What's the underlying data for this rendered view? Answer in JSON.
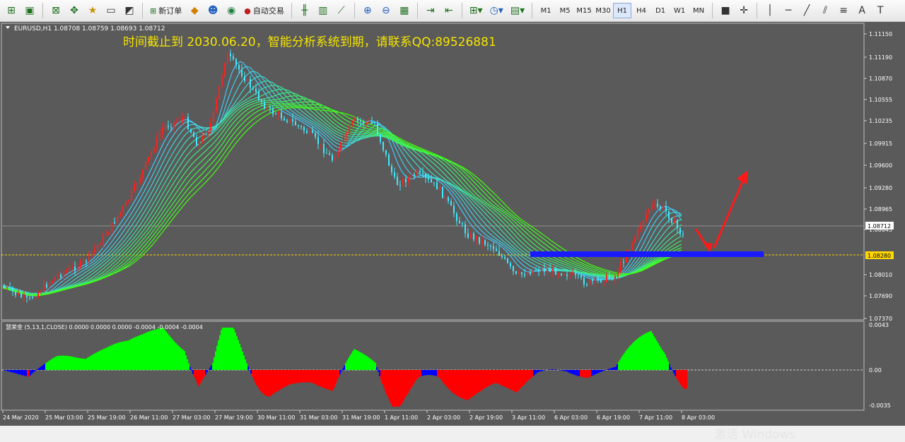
{
  "toolbar": {
    "new_order_label": "新订单",
    "autotrade_label": "自动交易",
    "timeframes": [
      "M1",
      "M5",
      "M15",
      "M30",
      "H1",
      "H4",
      "D1",
      "W1",
      "MN"
    ],
    "active_timeframe": "H1"
  },
  "chart": {
    "header": "EURUSD,H1  1.08708 1.08759 1.08693 1.08712",
    "notice": "时间截止到 2030.06.20，智能分析系统到期，请联系QQ:89526881",
    "price_ticks": [
      "1.11150",
      "1.11190",
      "1.10870",
      "1.10555",
      "1.10235",
      "1.09915",
      "1.09600",
      "1.09280",
      "1.08965",
      "1.08645",
      "1.08010",
      "1.07690",
      "1.07370"
    ],
    "current_price": "1.08712",
    "level_price": "1.08280",
    "indicator_header": "慧荣金 (5,13,1,CLOSE) 0.0000 0.0000 0.0000 -0.0004 -0.0004 -0.0004",
    "indicator_ticks": [
      "0.0043",
      "0.00",
      "-0.0035"
    ],
    "time_ticks": [
      "24 Mar 2020",
      "25 Mar 03:00",
      "25 Mar 19:00",
      "26 Mar 11:00",
      "27 Mar 03:00",
      "27 Mar 19:00",
      "30 Mar 11:00",
      "31 Mar 03:00",
      "31 Mar 19:00",
      "1 Apr 11:00",
      "2 Apr 03:00",
      "2 Apr 19:00",
      "3 Apr 11:00",
      "6 Apr 03:00",
      "6 Apr 19:00",
      "7 Apr 11:00",
      "8 Apr 03:00"
    ],
    "colors": {
      "bull": "#ff2020",
      "bear": "#40e8ff",
      "hist_up": "#00ff00",
      "hist_down": "#ff0000",
      "hist_blue": "#0000ff",
      "level": "#ffd700"
    }
  },
  "watermark": "激活 Windows"
}
